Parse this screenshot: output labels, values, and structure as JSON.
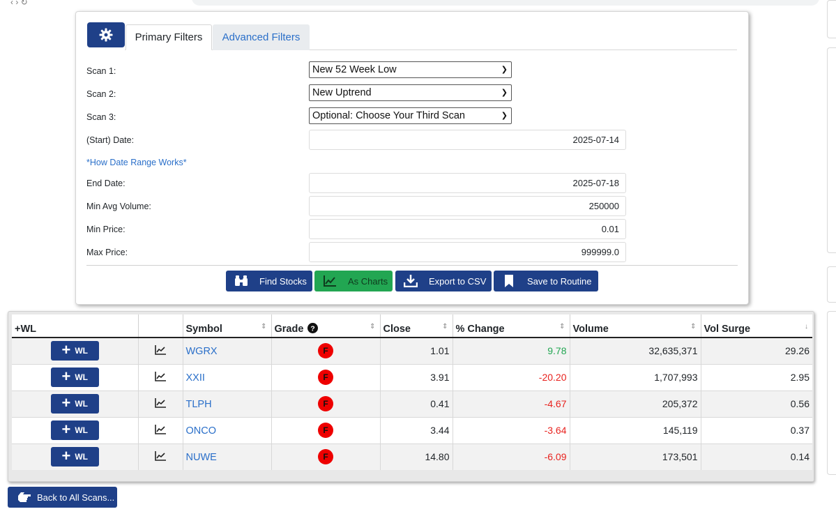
{
  "form": {
    "tabs": [
      {
        "label": "Primary Filters"
      },
      {
        "label": "Advanced Filters"
      }
    ],
    "scan1": {
      "label": "Scan 1:",
      "value": "New 52 Week Low"
    },
    "scan2": {
      "label": "Scan 2:",
      "value": "New Uptrend"
    },
    "scan3": {
      "label": "Scan 3:",
      "value": "Optional: Choose Your Third Scan"
    },
    "start_date": {
      "label": "(Start) Date:",
      "value": "2025-07-14"
    },
    "how_link": "*How Date Range Works*",
    "end_date": {
      "label": "End Date:",
      "value": "2025-07-18"
    },
    "min_avg_volume": {
      "label": "Min Avg Volume:",
      "value": "250000"
    },
    "min_price": {
      "label": "Min Price:",
      "value": "0.01"
    },
    "max_price": {
      "label": "Max Price:",
      "value": "999999.0"
    },
    "buttons": {
      "find": "Find Stocks",
      "charts": "As Charts",
      "export": "Export to CSV",
      "save": "Save to Routine"
    }
  },
  "results": {
    "headers": {
      "wl": "+WL",
      "chart": "",
      "symbol": "Symbol",
      "grade": "Grade",
      "close": "Close",
      "change": "% Change",
      "volume": "Volume",
      "vol_surge": "Vol Surge"
    },
    "wl_button_label": "WL",
    "rows": [
      {
        "symbol": "WGRX",
        "grade": "F",
        "close": "1.01",
        "change": "9.78",
        "volume": "32,635,371",
        "vol_surge": "29.26"
      },
      {
        "symbol": "XXII",
        "grade": "F",
        "close": "3.91",
        "change": "-20.20",
        "volume": "1,707,993",
        "vol_surge": "2.95"
      },
      {
        "symbol": "TLPH",
        "grade": "F",
        "close": "0.41",
        "change": "-4.67",
        "volume": "205,372",
        "vol_surge": "0.56"
      },
      {
        "symbol": "ONCO",
        "grade": "F",
        "close": "3.44",
        "change": "-3.64",
        "volume": "145,119",
        "vol_surge": "0.37"
      },
      {
        "symbol": "NUWE",
        "grade": "F",
        "close": "14.80",
        "change": "-6.09",
        "volume": "173,501",
        "vol_surge": "0.14"
      }
    ]
  },
  "back_button": "Back to All Scans...",
  "colors": {
    "primary": "#1f4088",
    "success": "#22a652",
    "negative": "#e8221e",
    "link": "#2a6fc9",
    "grade_badge": "#ee0000"
  },
  "icons": {
    "settings": "gear-icon",
    "find": "binoculars-icon",
    "charts": "line-chart-icon",
    "export": "download-icon",
    "save": "bookmark-icon",
    "back": "pointing-hand-icon",
    "grade_help": "question-circle-icon"
  }
}
